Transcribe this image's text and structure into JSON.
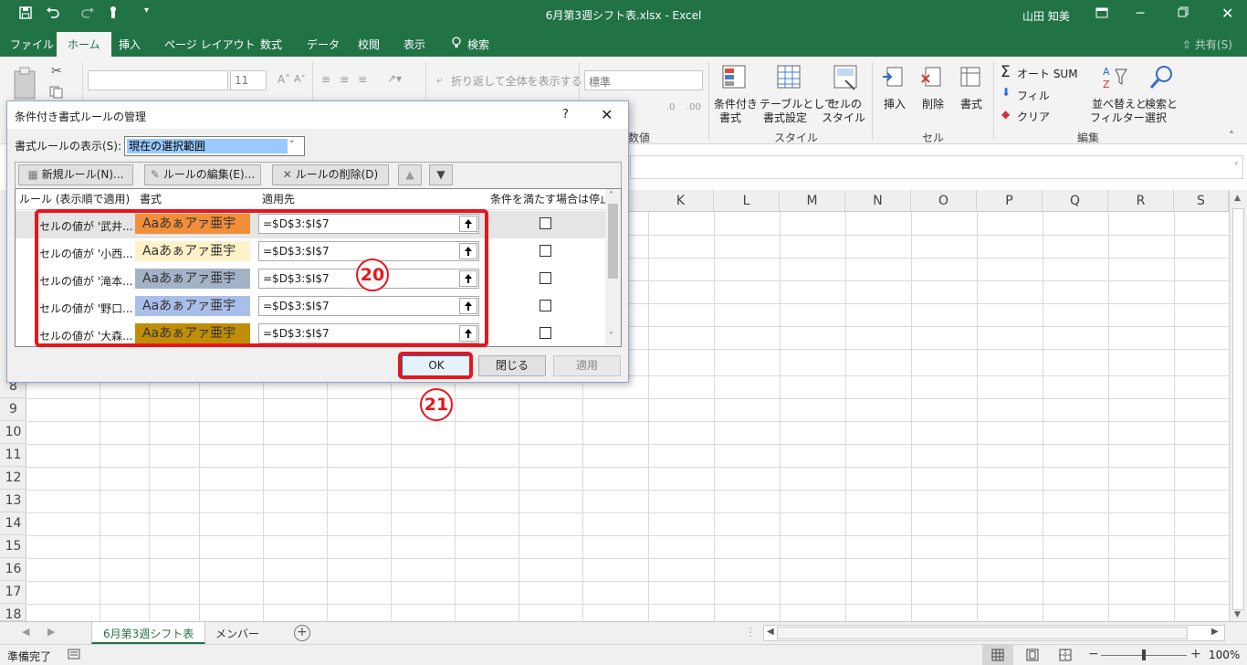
{
  "window": {
    "title": "6月第3週シフト表.xlsx  -  Excel",
    "user": "山田 知美"
  },
  "tabs": [
    "ファイル",
    "ホーム",
    "挿入",
    "ページ レイアウト",
    "数式",
    "データ",
    "校閲",
    "表示",
    "検索"
  ],
  "share_label": "共有(S)",
  "ribbon": {
    "font_size": "11",
    "wrap_text": "折り返して全体を表示する",
    "number_format": "標準",
    "number_group": "数値",
    "cond_format": "条件付き",
    "cond_format2": "書式",
    "table_format": "テーブルとして",
    "table_format2": "書式設定",
    "cell_style": "セルの",
    "cell_style2": "スタイル",
    "style_group": "スタイル",
    "insert": "挿入",
    "delete": "削除",
    "format": "書式",
    "cell_group": "セル",
    "autosum": "オート SUM",
    "fill": "フィル",
    "clear": "クリア",
    "sort": "並べ替えと",
    "sort2": "フィルター",
    "find": "検索と",
    "find2": "選択",
    "edit_group": "編集"
  },
  "columns": [
    "K",
    "L",
    "M",
    "N",
    "O",
    "P",
    "Q",
    "R",
    "S"
  ],
  "rows": [
    "8",
    "9",
    "10",
    "11",
    "12",
    "13",
    "14",
    "15",
    "16",
    "17",
    "18"
  ],
  "dialog": {
    "title": "条件付き書式ルールの管理",
    "help": "?",
    "show_label": "書式ルールの表示(S):",
    "show_value": "現在の選択範囲",
    "new_rule": "新規ルール(N)...",
    "edit_rule": "ルールの編集(E)...",
    "delete_rule": "ルールの削除(D)",
    "col_rule": "ルール (表示順で適用)",
    "col_format": "書式",
    "col_apply": "適用先",
    "col_stop": "条件を満たす場合は停止",
    "rules": [
      {
        "name": "セルの値が '武井...",
        "preview": "Aaあぁアァ亜宇",
        "color": "#f08e3a",
        "apply": "=$D$3:$I$7"
      },
      {
        "name": "セルの値が '小西...",
        "preview": "Aaあぁアァ亜宇",
        "color": "#fff2c8",
        "apply": "=$D$3:$I$7"
      },
      {
        "name": "セルの値が '滝本...",
        "preview": "Aaあぁアァ亜宇",
        "color": "#a3b2c6",
        "apply": "=$D$3:$I$7"
      },
      {
        "name": "セルの値が '野口...",
        "preview": "Aaあぁアァ亜宇",
        "color": "#a9bfe9",
        "apply": "=$D$3:$I$7"
      },
      {
        "name": "セルの値が '大森...",
        "preview": "Aaあぁアァ亜宇",
        "color": "#c08e06",
        "apply": "=$D$3:$I$7"
      }
    ],
    "ok": "OK",
    "close": "閉じる",
    "apply": "適用"
  },
  "annotations": {
    "step20": "20",
    "step21": "21"
  },
  "sheets": [
    "6月第3週シフト表",
    "メンバー"
  ],
  "status": {
    "ready": "準備完了",
    "zoom": "100%"
  }
}
